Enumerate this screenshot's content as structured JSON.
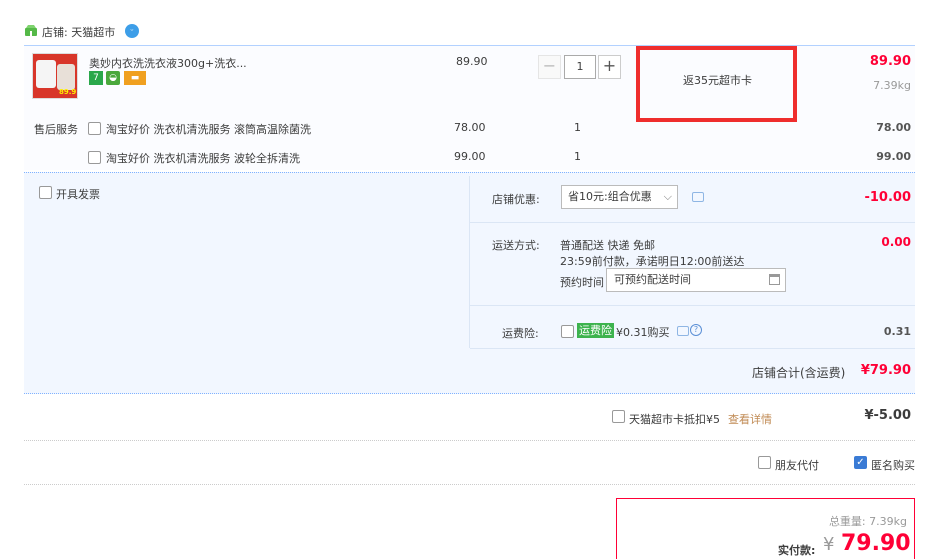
{
  "shop": {
    "label": "店铺: 天猫超市"
  },
  "item": {
    "title": "奥妙内衣洗洗衣液300g+洗衣...",
    "image_price_tag": "89.9",
    "badge_1": "7",
    "unit_price": "89.90",
    "quantity": "1",
    "minus": "−",
    "plus": "+",
    "promo": "返35元超市卡",
    "total": "89.90",
    "weight": "7.39kg"
  },
  "services": {
    "label": "售后服务",
    "rows": [
      {
        "name": "淘宝好价 洗衣机清洗服务 滚筒高温除菌洗",
        "price": "78.00",
        "qty": "1",
        "total": "78.00"
      },
      {
        "name": "淘宝好价 洗衣机清洗服务 波轮全拆清洗",
        "price": "99.00",
        "qty": "1",
        "total": "99.00"
      }
    ]
  },
  "options": {
    "invoice_label": "开具发票",
    "coupon_label": "店铺优惠:",
    "coupon_selected": "省10元:组合优惠",
    "coupon_amount": "-10.00",
    "shipping_label": "运送方式:",
    "shipping_line1": "普通配送 快递 免邮",
    "shipping_line2": "23:59前付款，承诺明日12:00前送达",
    "appointment_label": "预约时间",
    "appointment_placeholder": "可预约配送时间",
    "shipping_amount": "0.00",
    "insurance_label": "运费险:",
    "insurance_tag": "运费险",
    "insurance_text": "¥0.31购买",
    "insurance_amount": "0.31",
    "shop_total_label": "店铺合计(含运费)",
    "shop_total": "¥79.90"
  },
  "card": {
    "label": "天猫超市卡抵扣¥5",
    "link": "查看详情",
    "amount": "¥-5.00"
  },
  "friend_pay": "朋友代付",
  "anonymous": "匿名购买",
  "payment": {
    "weight_label": "总重量: 7.39kg",
    "label": "实付款:",
    "yen": "¥",
    "amount": "79.90"
  },
  "colors": {
    "accent": "#ff0036",
    "highlight_border": "#ef2d2d",
    "link": "#c08a53"
  }
}
